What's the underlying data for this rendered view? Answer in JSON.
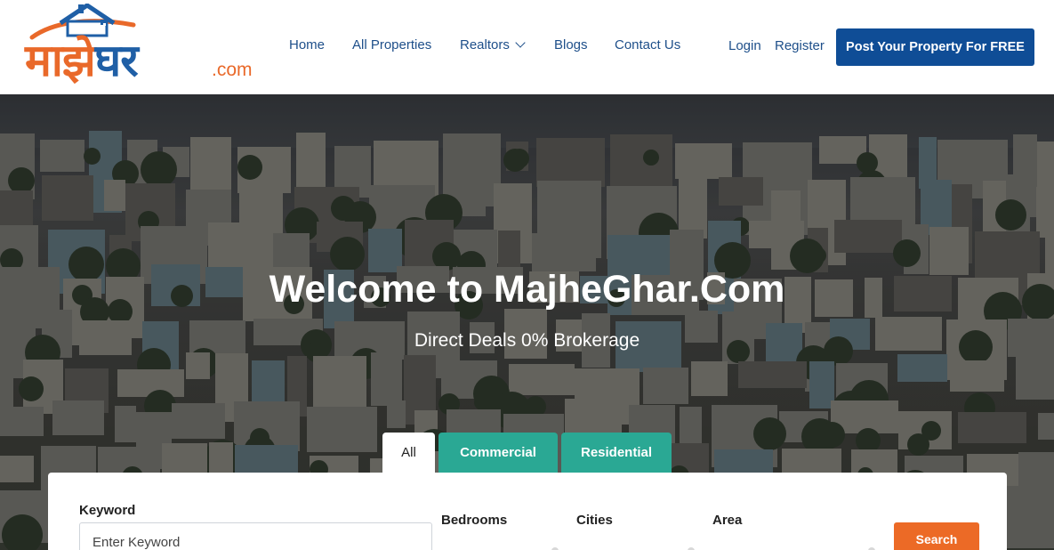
{
  "logo": {
    "main_part1": "माझे",
    "main_part2": "घर",
    "suffix": ".com"
  },
  "nav": {
    "home": "Home",
    "all_properties": "All Properties",
    "realtors": "Realtors",
    "blogs": "Blogs",
    "contact_us": "Contact Us",
    "login": "Login",
    "register": "Register",
    "post_property": "Post Your Property For FREE"
  },
  "hero": {
    "title": "Welcome to MajheGhar.Com",
    "subtitle": "Direct Deals 0% Brokerage"
  },
  "search": {
    "tabs": [
      "All",
      "Commercial",
      "Residential"
    ],
    "active_tab": "All",
    "keyword_label": "Keyword",
    "keyword_placeholder": "Enter Keyword",
    "bedrooms_label": "Bedrooms",
    "cities_label": "Cities",
    "area_label": "Area",
    "search_button": "Search"
  },
  "colors": {
    "brand_orange": "#ec6a26",
    "brand_blue": "#0f4d96",
    "tab_teal": "#2aa894"
  }
}
